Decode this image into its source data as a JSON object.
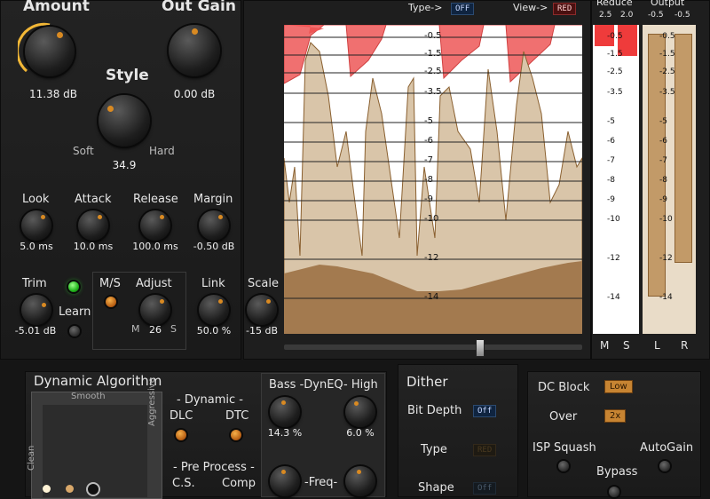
{
  "controls": {
    "amount": {
      "label": "Amount",
      "value": "11.38 dB"
    },
    "out_gain": {
      "label": "Out Gain",
      "value": "0.00 dB"
    },
    "style": {
      "label": "Style",
      "value": "34.9",
      "left": "Soft",
      "right": "Hard"
    },
    "look": {
      "label": "Look",
      "value": "5.0 ms"
    },
    "attack": {
      "label": "Attack",
      "value": "10.0 ms"
    },
    "release": {
      "label": "Release",
      "value": "100.0 ms"
    },
    "margin": {
      "label": "Margin",
      "value": "-0.50 dB"
    },
    "trim": {
      "label": "Trim",
      "value": "-5.01 dB"
    },
    "learn": {
      "label": "Learn"
    },
    "ms": {
      "label": "M/S"
    },
    "adjust": {
      "label": "Adjust",
      "value": "26",
      "left": "M",
      "right": "S"
    },
    "link": {
      "label": "Link",
      "value": "50.0 %"
    },
    "scale": {
      "label": "Scale",
      "value": "-15 dB"
    }
  },
  "display": {
    "type_label": "Type->",
    "type_value": "OFF",
    "view_label": "View->",
    "view_value": "RED",
    "scale_ticks": [
      "-0.5",
      "-1.5",
      "-2.5",
      "-3.5",
      "-5",
      "-6",
      "-7",
      "-8",
      "-9",
      "-10",
      "-12",
      "-14"
    ]
  },
  "meters": {
    "reduce": {
      "label": "Reduce",
      "scale": [
        "2.5",
        "2.0"
      ],
      "channels": [
        "M",
        "S"
      ]
    },
    "output": {
      "label": "Output",
      "scale": [
        "-0.5",
        "-0.5"
      ],
      "channels": [
        "L",
        "R"
      ]
    },
    "ticks": [
      "-0.5",
      "-1.5",
      "-2.5",
      "-3.5",
      "-5",
      "-6",
      "-7",
      "-8",
      "-9",
      "-10",
      "-12",
      "-14"
    ],
    "reduce_levels": {
      "M": 0.07,
      "S": 0.1
    },
    "output_levels": {
      "L": 0.88,
      "R": 0.77
    }
  },
  "dynamic_algorithm": {
    "title": "Dynamic Algorithm",
    "pad_top": "Smooth",
    "pad_left": "Clean",
    "pad_right": "Aggressive",
    "dynamic_label": "- Dynamic -",
    "dlc": "DLC",
    "dtc": "DTC",
    "preprocess_label": "- Pre Process -",
    "cs": "C.S.",
    "comp": "Comp"
  },
  "dyneq": {
    "title": "Bass -DynEQ- High",
    "bass_value": "14.3 %",
    "high_value": "6.0 %",
    "freq_label": "-Freq-"
  },
  "dither": {
    "title": "Dither",
    "bit_depth_label": "Bit Depth",
    "bit_depth_value": "Off",
    "type_label": "Type",
    "type_value": "RED",
    "shape_label": "Shape",
    "shape_value": "Off"
  },
  "right_panel": {
    "dc_block_label": "DC Block",
    "dc_block_value": "Low",
    "over_label": "Over",
    "over_value": "2x",
    "isp_label": "ISP Squash",
    "autogain_label": "AutoGain",
    "bypass_label": "Bypass"
  },
  "colors": {
    "accent": "#d98a22",
    "waveform": "#a37a4f",
    "reduction": "#f06868",
    "led_green": "#33dd33"
  }
}
